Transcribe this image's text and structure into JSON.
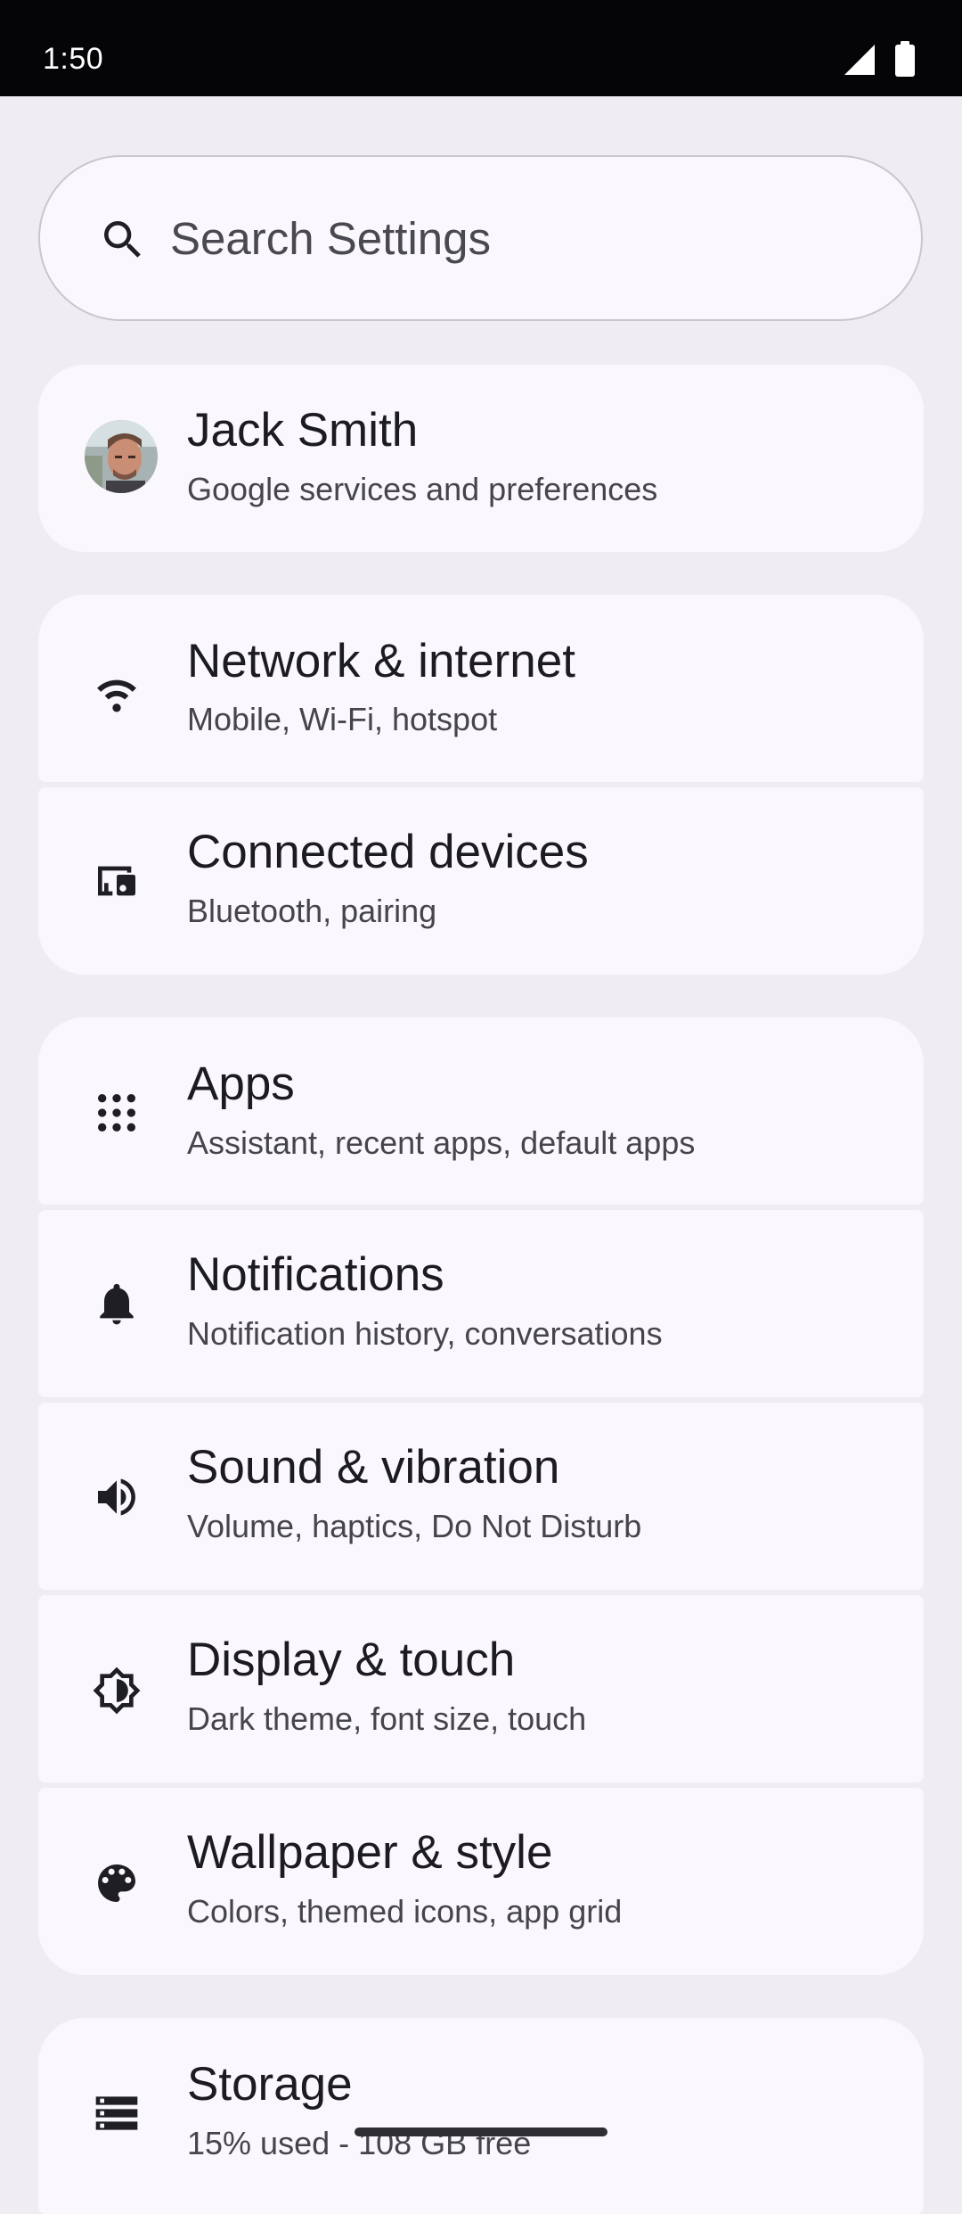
{
  "status_bar": {
    "time": "1:50",
    "icons": [
      "cellular-signal-icon",
      "battery-icon"
    ]
  },
  "search": {
    "placeholder": "Search Settings",
    "icon": "search-icon"
  },
  "account": {
    "name": "Jack Smith",
    "subtitle": "Google services and preferences"
  },
  "settings_items": [
    {
      "id": "network",
      "icon": "wifi-icon",
      "title": "Network & internet",
      "subtitle": "Mobile, Wi-Fi, hotspot"
    },
    {
      "id": "connected-devices",
      "icon": "connected-devices-icon",
      "title": "Connected devices",
      "subtitle": "Bluetooth, pairing"
    },
    {
      "id": "apps",
      "icon": "apps-grid-icon",
      "title": "Apps",
      "subtitle": "Assistant, recent apps, default apps"
    },
    {
      "id": "notifications",
      "icon": "bell-icon",
      "title": "Notifications",
      "subtitle": "Notification history, conversations"
    },
    {
      "id": "sound",
      "icon": "speaker-icon",
      "title": "Sound & vibration",
      "subtitle": "Volume, haptics, Do Not Disturb"
    },
    {
      "id": "display",
      "icon": "brightness-icon",
      "title": "Display & touch",
      "subtitle": "Dark theme, font size, touch"
    },
    {
      "id": "wallpaper",
      "icon": "palette-icon",
      "title": "Wallpaper & style",
      "subtitle": "Colors, themed icons, app grid"
    },
    {
      "id": "storage",
      "icon": "storage-icon",
      "title": "Storage",
      "subtitle": "15% used - 108 GB free"
    }
  ],
  "colors": {
    "background": "#efedf2",
    "card": "#fbf8fd",
    "status_bar": "#050406",
    "title_text": "#1c1b20",
    "subtitle_text": "#46444c"
  }
}
